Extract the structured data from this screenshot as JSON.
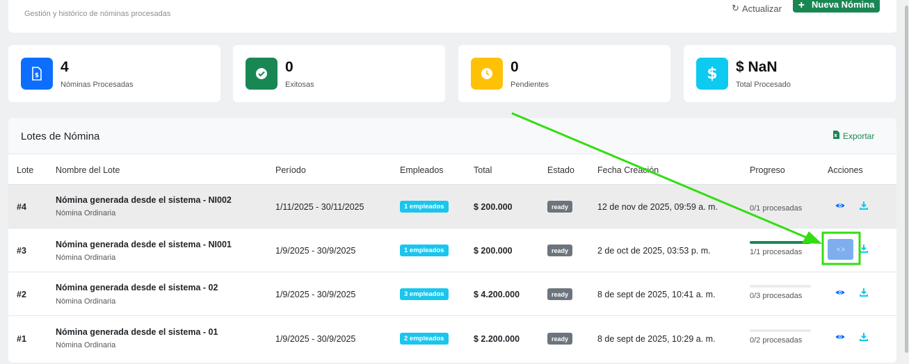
{
  "header": {
    "subtitle": "Gestión y histórico de nóminas procesadas",
    "refresh_label": "Actualizar",
    "new_label": "Nueva Nómina"
  },
  "stats": [
    {
      "value": "4",
      "label": "Nóminas Procesadas",
      "icon": "file-dollar-icon",
      "color": "#0d6efd"
    },
    {
      "value": "0",
      "label": "Exitosas",
      "icon": "check-circle-icon",
      "color": "#198754"
    },
    {
      "value": "0",
      "label": "Pendientes",
      "icon": "clock-icon",
      "color": "#ffc107"
    },
    {
      "value": "$ NaN",
      "label": "Total Procesado",
      "icon": "dollar-icon",
      "color": "#0dcaf0"
    }
  ],
  "table": {
    "title": "Lotes de Nómina",
    "export_label": "Exportar",
    "columns": [
      "Lote",
      "Nombre del Lote",
      "Período",
      "Empleados",
      "Total",
      "Estado",
      "Fecha Creación",
      "Progreso",
      "Acciones"
    ],
    "rows": [
      {
        "id": "#4",
        "name": "Nómina generada desde el sistema - NI002",
        "type": "Nómina Ordinaria",
        "period": "1/11/2025 - 30/11/2025",
        "employees": "1 empleados",
        "total": "$ 200.000",
        "status": "ready",
        "created": "12 de nov de 2025, 09:59 a. m.",
        "progress_text": "0/1 procesadas",
        "progress": 0
      },
      {
        "id": "#3",
        "name": "Nómina generada desde el sistema - NI001",
        "type": "Nómina Ordinaria",
        "period": "1/9/2025 - 30/9/2025",
        "employees": "1 empleados",
        "total": "$ 200.000",
        "status": "ready",
        "created": "2 de oct de 2025, 03:53 p. m.",
        "progress_text": "1/1 procesadas",
        "progress": 1
      },
      {
        "id": "#2",
        "name": "Nómina generada desde el sistema - 02",
        "type": "Nómina Ordinaria",
        "period": "1/9/2025 - 30/9/2025",
        "employees": "3 empleados",
        "total": "$ 4.200.000",
        "status": "ready",
        "created": "8 de sept de 2025, 10:41 a. m.",
        "progress_text": "0/3 procesadas",
        "progress": 0
      },
      {
        "id": "#1",
        "name": "Nómina generada desde el sistema - 01",
        "type": "Nómina Ordinaria",
        "period": "1/9/2025 - 30/9/2025",
        "employees": "2 empleados",
        "total": "$ 2.200.000",
        "status": "ready",
        "created": "8 de sept de 2025, 10:29 a. m.",
        "progress_text": "0/2 procesadas",
        "progress": 0
      }
    ]
  },
  "colors": {
    "primary": "#0d6efd",
    "success": "#198754",
    "info": "#0dcaf0",
    "annotation": "#33dd11"
  }
}
